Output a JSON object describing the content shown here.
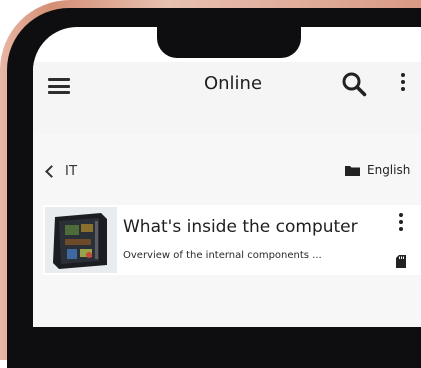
{
  "app_bar": {
    "title": "Online",
    "menu_icon": "hamburger-menu-icon",
    "search_icon": "search-icon",
    "more_icon": "more-vertical-icon"
  },
  "breadcrumb": {
    "label": "IT",
    "icon": "chevron-left-icon"
  },
  "language": {
    "label": "English",
    "icon": "folder-icon"
  },
  "items": [
    {
      "title": "What's inside the computer",
      "subtitle": "Overview of the internal components ...",
      "thumbnail": "computer-case-thumbnail",
      "more_icon": "more-vertical-icon",
      "status_icon": "sd-card-icon"
    }
  ],
  "colors": {
    "frame_dark": "#0e0e10",
    "frame_copper": "#d48f74",
    "app_bar_bg": "#f5f5f5",
    "content_bg": "#f7f7f7",
    "text": "#1e1e1e"
  }
}
